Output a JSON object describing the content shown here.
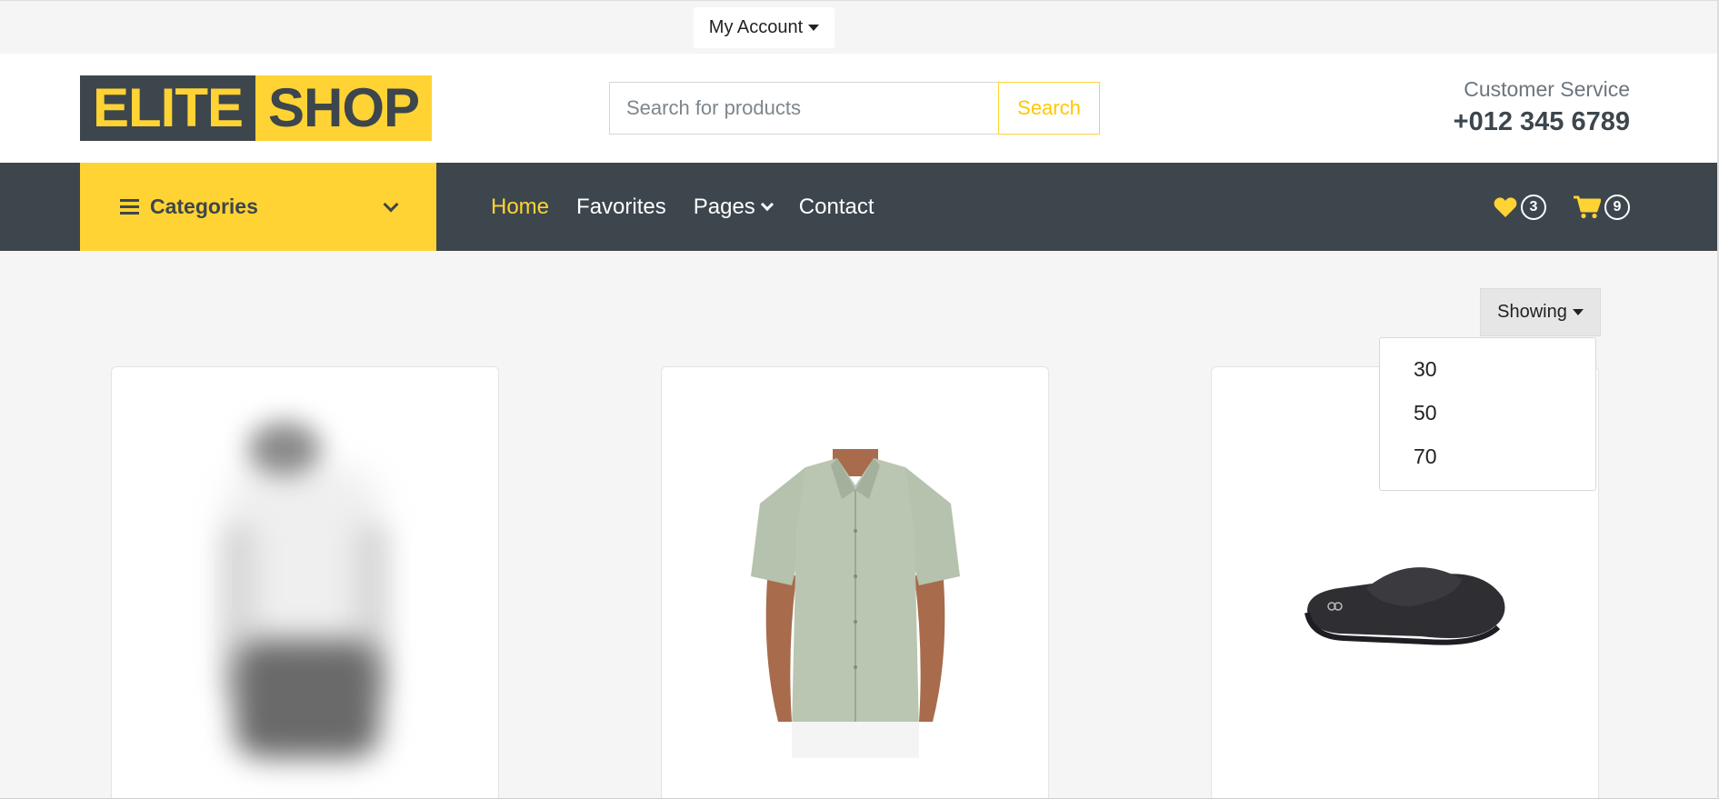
{
  "topbar": {
    "account_label": "My Account"
  },
  "header": {
    "logo_part1": "ELITE",
    "logo_part2": "SHOP",
    "search_placeholder": "Search for products",
    "search_button": "Search",
    "customer_service_label": "Customer Service",
    "customer_service_phone": "+012 345 6789"
  },
  "nav": {
    "categories_label": "Categories",
    "items": [
      {
        "label": "Home",
        "active": true
      },
      {
        "label": "Favorites"
      },
      {
        "label": "Pages",
        "has_dropdown": true
      },
      {
        "label": "Contact"
      }
    ],
    "favorites_count": "3",
    "cart_count": "9"
  },
  "toolbar": {
    "showing_label": "Showing",
    "options": [
      "30",
      "50",
      "70"
    ]
  },
  "products": [
    {
      "image": "blurred-product-photo"
    },
    {
      "image": "green-short-sleeve-shirt"
    },
    {
      "image": "black-slide-sandal"
    }
  ],
  "colors": {
    "accent": "#ffd333",
    "dark": "#3d464d",
    "background": "#f5f5f5"
  },
  "icons": {
    "favorites": "heart-icon",
    "cart": "cart-icon",
    "categories": "menu-icon"
  }
}
